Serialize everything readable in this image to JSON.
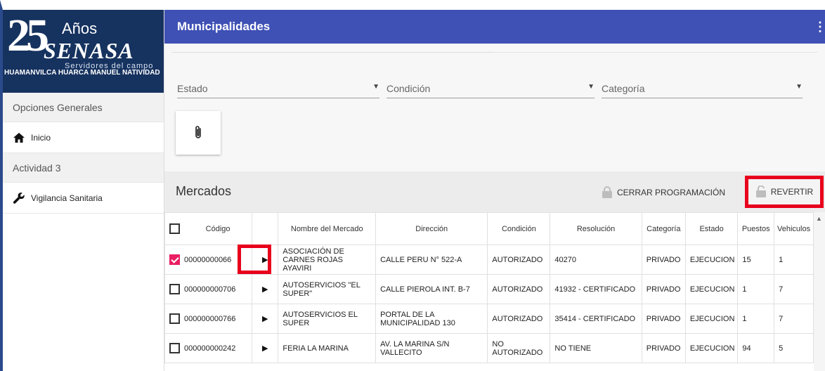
{
  "sidebar": {
    "logo": {
      "number": "25",
      "anos": "Años",
      "brand": "SENASA",
      "tagline": "Servidores del campo"
    },
    "user_name": "HUAMANVILCA HUARCA MANUEL NATIVIDAD",
    "sections": [
      {
        "label": "Opciones Generales"
      },
      {
        "label": "Actividad 3"
      }
    ],
    "items": [
      {
        "label": "Inicio",
        "icon": "home-icon"
      },
      {
        "label": "Vigilancia Sanitaria",
        "icon": "wrench-icon"
      }
    ]
  },
  "topbar": {
    "title": "Municipalidades",
    "menu_icon": "kebab-icon"
  },
  "filters": {
    "estado": "Estado",
    "condicion": "Condición",
    "categoria": "Categoría"
  },
  "mercados": {
    "title": "Mercados",
    "cerrar_label": "CERRAR PROGRAMACIÓN",
    "revertir_label": "REVERTIR"
  },
  "table": {
    "headers": [
      "Código",
      "",
      "Nombre del Mercado",
      "Dirección",
      "Condición",
      "Resolución",
      "Categoría",
      "Estado",
      "Puestos",
      "Vehiculos"
    ],
    "rows": [
      {
        "checked": true,
        "codigo": "00000000066",
        "nombre": "ASOCIACIÓN DE CARNES ROJAS AYAVIRI",
        "direccion": "CALLE PERU N° 522-A",
        "condicion": "AUTORIZADO",
        "resolucion": "40270",
        "categoria": "PRIVADO",
        "estado": "EJECUCION",
        "puestos": "15",
        "vehiculos": "1"
      },
      {
        "checked": false,
        "codigo": "000000000706",
        "nombre": "AUTOSERVICIOS \"EL SUPER\"",
        "direccion": "CALLE PIEROLA INT. B-7",
        "condicion": "AUTORIZADO",
        "resolucion": "41932 - CERTIFICADO",
        "categoria": "PRIVADO",
        "estado": "EJECUCION",
        "puestos": "1",
        "vehiculos": "7"
      },
      {
        "checked": false,
        "codigo": "000000000766",
        "nombre": "AUTOSERVICIOS EL SUPER",
        "direccion": "PORTAL DE LA MUNICIPALIDAD 130",
        "condicion": "AUTORIZADO",
        "resolucion": "35414 - CERTIFICADO",
        "categoria": "PRIVADO",
        "estado": "EJECUCION",
        "puestos": "1",
        "vehiculos": "7"
      },
      {
        "checked": false,
        "codigo": "000000000242",
        "nombre": "FERIA LA MARINA",
        "direccion": "AV. LA MARINA S/N VALLECITO",
        "condicion": "NO AUTORIZADO",
        "resolucion": "NO TIENE",
        "categoria": "PRIVADO",
        "estado": "EJECUCION",
        "puestos": "94",
        "vehiculos": "5"
      }
    ]
  },
  "colors": {
    "header": "#3f51b5",
    "highlight": "#e8001c",
    "check": "#e91e63",
    "logo_bg": "#16325f"
  }
}
